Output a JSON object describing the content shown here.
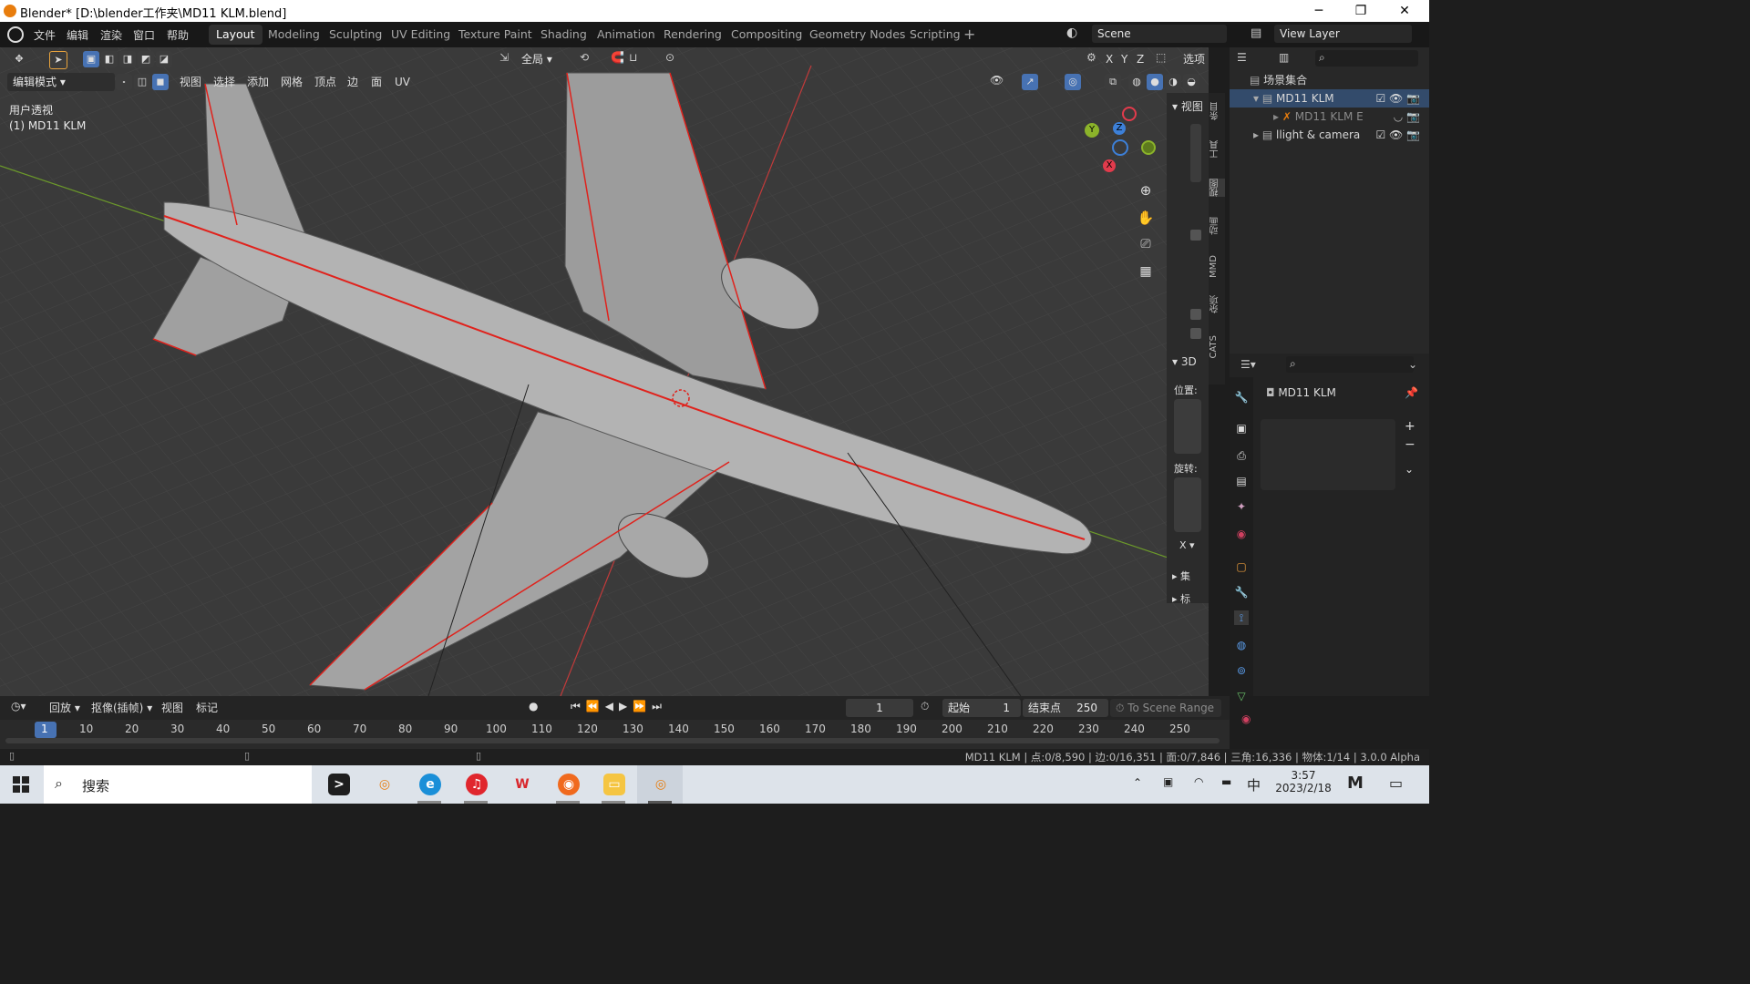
{
  "window": {
    "title": "Blender* [D:\\blender工作夹\\MD11 KLM.blend]",
    "minimize": "─",
    "restore": "❐",
    "close": "✕"
  },
  "menu": [
    "文件",
    "编辑",
    "渲染",
    "窗口",
    "帮助"
  ],
  "workspaces": [
    "Layout",
    "Modeling",
    "Sculpting",
    "UV Editing",
    "Texture Paint",
    "Shading",
    "Animation",
    "Rendering",
    "Compositing",
    "Geometry Nodes",
    "Scripting"
  ],
  "active_workspace": "Layout",
  "scene": {
    "name": "Scene",
    "view_layer": "View Layer"
  },
  "viewport_header": {
    "mode": "编辑模式",
    "menus": [
      "视图",
      "选择",
      "添加",
      "网格",
      "顶点",
      "边",
      "面",
      "UV"
    ],
    "transform_orientation": "全局",
    "axes": [
      "X",
      "Y",
      "Z"
    ],
    "options": "选项"
  },
  "viewport_overlay": {
    "view_name": "用户透视",
    "object_name": "(1) MD11 KLM"
  },
  "gizmo": {
    "y": "Y",
    "z": "Z",
    "x": "X"
  },
  "npanel": {
    "view_label": "视图",
    "3d_cursor_label": "3D",
    "location": "位置:",
    "rotation": "旋转:",
    "rot_mode": "X",
    "collapsed_1": "集",
    "collapsed_2": "标"
  },
  "npanel_tabs": [
    "条目",
    "工具",
    "视图",
    "动画",
    "MMD",
    "杂项",
    "CATS"
  ],
  "outliner": {
    "root": "场景集合",
    "items": [
      {
        "label": "MD11 KLM"
      },
      {
        "label": "MD11 KLM E"
      },
      {
        "label": "llight & camera"
      }
    ]
  },
  "properties": {
    "object_name": "MD11 KLM",
    "add": "+",
    "remove": "−"
  },
  "timeline": {
    "playback": "回放",
    "keying": "抠像(插帧)",
    "view": "视图",
    "marker": "标记",
    "current_frame": "1",
    "start_label": "起始",
    "start": "1",
    "end_label": "结束点",
    "end": "250",
    "to_scene_range": "To Scene Range",
    "ticks": [
      "1",
      "10",
      "20",
      "30",
      "40",
      "50",
      "60",
      "70",
      "80",
      "90",
      "100",
      "110",
      "120",
      "130",
      "140",
      "150",
      "160",
      "170",
      "180",
      "190",
      "200",
      "210",
      "220",
      "230",
      "240",
      "250"
    ]
  },
  "statusbar": {
    "stats": "MD11 KLM | 点:0/8,590 | 边:0/16,351 | 面:0/7,846 | 三角:16,336 | 物体:1/14 | 3.0.0 Alpha"
  },
  "taskbar": {
    "search": "搜索",
    "ime": "中",
    "time": "3:57",
    "date": "2023/2/18"
  },
  "colors": {
    "accent": "#4772b3",
    "edge_seam": "#e0221c",
    "blender_orange": "#e87d0d",
    "gizmo_x": "#e23b4c",
    "gizmo_y": "#8bb32a",
    "gizmo_z": "#3d80d8"
  }
}
